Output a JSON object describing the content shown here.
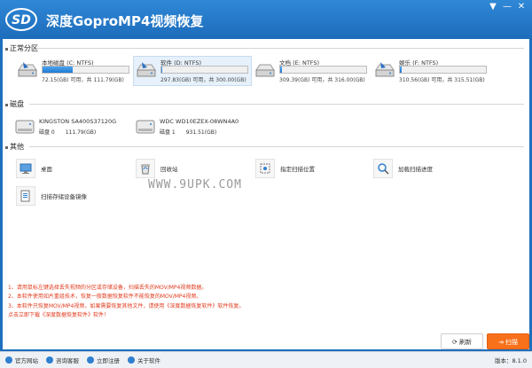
{
  "app": {
    "title": "深度GoproMP4视频恢复",
    "logo_text": "SD"
  },
  "window_controls": [
    "▼",
    "—",
    "✕"
  ],
  "sections": {
    "partitions": "正常分区",
    "disks": "磁盘",
    "others": "其他"
  },
  "drives": [
    {
      "name": "本地磁盘 (C: NTFS)",
      "capacity": "72.15(GB) 可用，共 111.79(GB)",
      "used_fraction": 0.35
    },
    {
      "name": "软件 (D: NTFS)",
      "capacity": "297.83(GB) 可用，共 300.00(GB)",
      "used_fraction": 0.01
    },
    {
      "name": "文档 (E: NTFS)",
      "capacity": "309.39(GB) 可用，共 316.00(GB)",
      "used_fraction": 0.02
    },
    {
      "name": "娱乐 (F: NTFS)",
      "capacity": "310.56(GB) 可用，共 315.51(GB)",
      "used_fraction": 0.02
    }
  ],
  "disks": [
    {
      "name": "KINGSTON SA400S37120G",
      "index": "磁盘 0",
      "size": "111.79(GB)"
    },
    {
      "name": "WDC WD10EZEX-08WN4A0",
      "index": "磁盘 1",
      "size": "931.51(GB)"
    }
  ],
  "others": [
    {
      "label": "桌面",
      "icon": "desktop-icon"
    },
    {
      "label": "回收站",
      "icon": "recycle-bin-icon"
    },
    {
      "label": "指定扫描位置",
      "icon": "target-location-icon"
    },
    {
      "label": "加载扫描进度",
      "icon": "load-progress-icon"
    },
    {
      "label": "扫描存储设备镜像",
      "icon": "disk-image-icon"
    }
  ],
  "watermark": "WWW.9UPK.COM",
  "notes": [
    "1、请用鼠标左键选择丢失视频的分区或存储设备，扫描丢失的MOV/MP4视频数据。",
    "2、本软件使用如片重组技术，恢复一般数据恢复软件不能恢复的MOV/MP4视频。",
    "3、本软件只恢复MOV/MP4视频，如果需要恢复其他文件，请使用《深度数据恢复软件》软件恢复。",
    "   点击立即下载《深度数据恢复软件》软件！"
  ],
  "buttons": {
    "refresh": "刷新",
    "scan": "扫描"
  },
  "statusbar": {
    "website": "官方网站",
    "support": "咨询客服",
    "register": "立即注册",
    "about": "关于软件",
    "version": "版本：8.1.0"
  },
  "colors": {
    "accent": "#1e6fbd",
    "scan_button": "#f7711b",
    "notes": "#e03a1d"
  }
}
